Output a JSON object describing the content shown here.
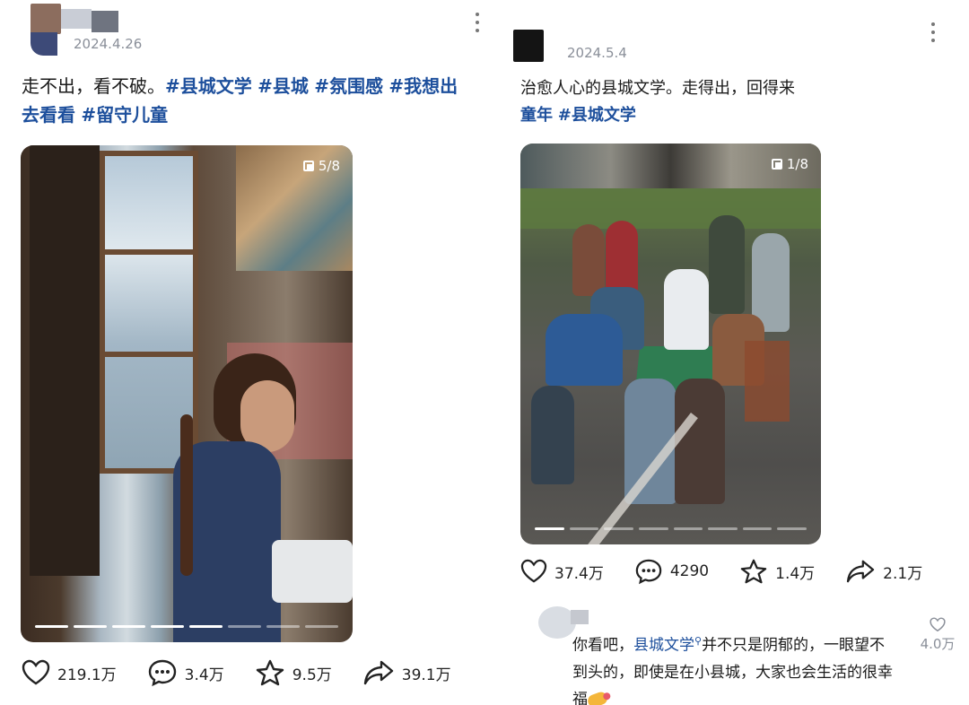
{
  "posts": [
    {
      "date": "2024.4.26",
      "caption_text": "走不出，看不破。",
      "tags": [
        "#县城文学",
        "#县城",
        "#氛围感",
        "#我想出去看看",
        "#留守儿童"
      ],
      "image_counter": "5/8",
      "progress_total": 8,
      "progress_current": 5,
      "stats": {
        "likes": "219.1万",
        "comments": "3.4万",
        "favorites": "9.5万",
        "shares": "39.1万"
      }
    },
    {
      "date": "2024.5.4",
      "caption_text": "治愈人心的县城文学。走得出，回得来",
      "tags": [
        "童年",
        "#县城文学"
      ],
      "image_counter": "1/8",
      "progress_total": 8,
      "progress_current": 1,
      "stats": {
        "likes": "37.4万",
        "comments": "4290",
        "favorites": "1.4万",
        "shares": "2.1万"
      },
      "top_comment": {
        "prefix": "你看吧，",
        "link": "县城文学",
        "text": "并不只是阴郁的，一眼望不到头的，即使是在小县城，大家也会生活的很幸福",
        "likes": "4.0万"
      }
    }
  ],
  "icons": {
    "like": "heart-icon",
    "comment": "comment-bubble-icon",
    "favorite": "star-icon",
    "share": "share-arrow-icon",
    "more": "more-vertical-icon",
    "counter": "multi-image-icon"
  },
  "colors": {
    "tag": "#1d4f9c",
    "meta": "#8a8f99"
  }
}
